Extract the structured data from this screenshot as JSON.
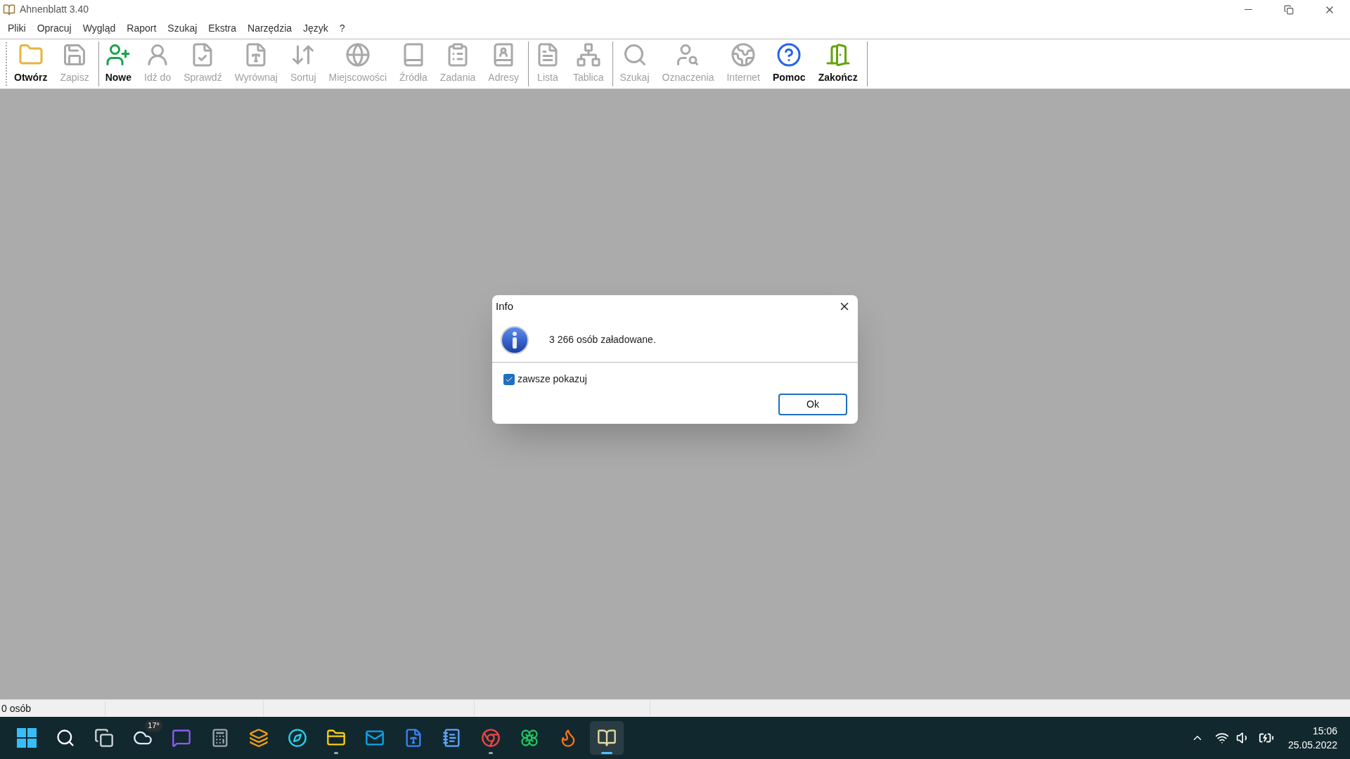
{
  "window": {
    "title": "Ahnenblatt 3.40"
  },
  "menu": [
    "Pliki",
    "Opracuj",
    "Wygląd",
    "Raport",
    "Szukaj",
    "Ekstra",
    "Narzędzia",
    "Język",
    "?"
  ],
  "toolbar": {
    "groups": [
      {
        "buttons": [
          {
            "label": "Otwórz",
            "disabled": false
          },
          {
            "label": "Zapisz",
            "disabled": true
          }
        ]
      },
      {
        "buttons": [
          {
            "label": "Nowe",
            "disabled": false
          },
          {
            "label": "Idź do",
            "disabled": true
          },
          {
            "label": "Sprawdź",
            "disabled": true
          },
          {
            "label": "Wyrównaj",
            "disabled": true
          },
          {
            "label": "Sortuj",
            "disabled": true
          },
          {
            "label": "Miejscowości",
            "disabled": true
          },
          {
            "label": "Źródła",
            "disabled": true
          },
          {
            "label": "Zadania",
            "disabled": true
          },
          {
            "label": "Adresy",
            "disabled": true
          }
        ]
      },
      {
        "buttons": [
          {
            "label": "Lista",
            "disabled": true
          },
          {
            "label": "Tablica",
            "disabled": true
          }
        ]
      },
      {
        "buttons": [
          {
            "label": "Szukaj",
            "disabled": true
          },
          {
            "label": "Oznaczenia",
            "disabled": true
          },
          {
            "label": "Internet",
            "disabled": true
          },
          {
            "label": "Pomoc",
            "disabled": false
          },
          {
            "label": "Zakończ",
            "disabled": false
          }
        ]
      }
    ]
  },
  "dialog": {
    "title": "Info",
    "message": "3 266 osób załadowane.",
    "checkbox": {
      "label": "zawsze pokazuj",
      "checked": true
    },
    "button": "Ok"
  },
  "status_bar": [
    "0 osób"
  ],
  "taskbar": {
    "apps": [
      {
        "running": false,
        "selected": false
      },
      {
        "running": false,
        "selected": false
      },
      {
        "running": false,
        "selected": false
      },
      {
        "running": false,
        "selected": false,
        "badge": "17°"
      },
      {
        "running": false,
        "selected": false
      },
      {
        "running": false,
        "selected": false
      },
      {
        "running": false,
        "selected": false
      },
      {
        "running": false,
        "selected": false
      },
      {
        "running": true,
        "selected": false
      },
      {
        "running": false,
        "selected": false
      },
      {
        "running": false,
        "selected": false
      },
      {
        "running": false,
        "selected": false
      },
      {
        "running": true,
        "selected": false
      },
      {
        "running": false,
        "selected": false
      },
      {
        "running": false,
        "selected": false
      },
      {
        "running": true,
        "selected": true
      }
    ],
    "time": "15:06",
    "date": "25.05.2022"
  }
}
